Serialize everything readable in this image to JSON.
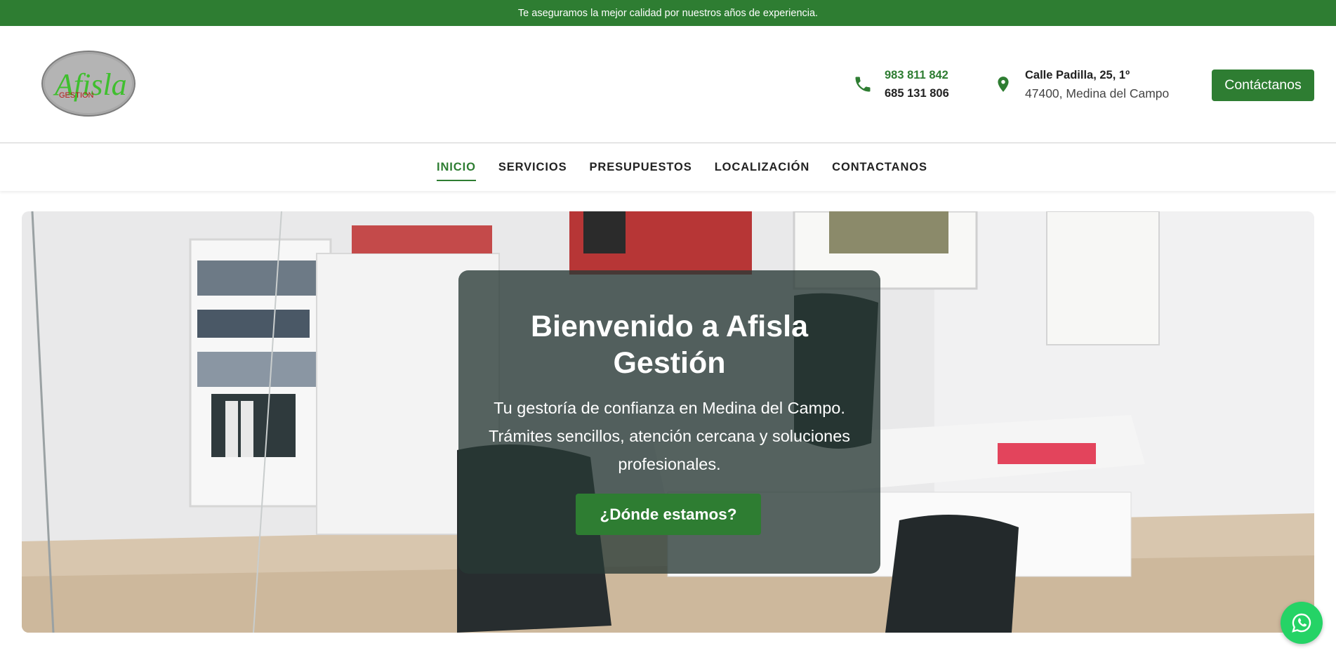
{
  "topbar": {
    "text": "Te aseguramos la mejor calidad por nuestros años de experiencia."
  },
  "header": {
    "logo_text": "Afisla",
    "logo_sub": "GESTION",
    "phone_primary": "983 811 842",
    "phone_secondary": "685 131 806",
    "address_line1": "Calle Padilla, 25, 1º",
    "address_line2": "47400, Medina del Campo",
    "cta_label": "Contáctanos"
  },
  "nav": {
    "items": [
      {
        "label": "INICIO"
      },
      {
        "label": "SERVICIOS"
      },
      {
        "label": "PRESUPUESTOS"
      },
      {
        "label": "LOCALIZACIÓN"
      },
      {
        "label": "CONTACTANOS"
      }
    ],
    "active_index": 0
  },
  "hero": {
    "title": "Bienvenido a Afisla Gestión",
    "subtitle": "Tu gestoría de confianza en Medina del Campo. Trámites sencillos, atención cercana y soluciones profesionales.",
    "button_label": "¿Dónde estamos?"
  },
  "floating": {
    "icon": "whatsapp-icon"
  },
  "colors": {
    "brand": "#2e7d32",
    "whatsapp": "#25d366"
  }
}
